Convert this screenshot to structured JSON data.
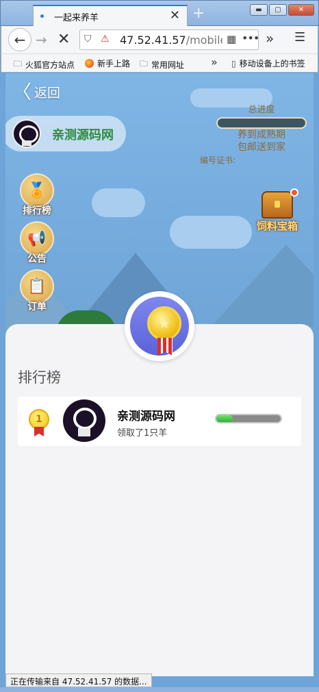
{
  "browser": {
    "tab_title": "一起来养羊",
    "url_host": "47.52.41.57",
    "url_path": "/mobile/she",
    "bookmarks": [
      "火狐官方站点",
      "新手上路",
      "常用网址",
      "移动设备上的书签"
    ],
    "status_text": "正在传输来自 47.52.41.57 的数据..."
  },
  "game": {
    "back_label": "返回",
    "username": "亲测源码网",
    "progress": {
      "title": "总进度",
      "line1": "养到成熟期",
      "line2": "包邮送到家",
      "cert_label": "编号证书:"
    },
    "side_menu": [
      {
        "label": "排行榜"
      },
      {
        "label": "公告"
      },
      {
        "label": "订单"
      }
    ],
    "chest_label": "饲料宝箱"
  },
  "ranking": {
    "title": "排行榜",
    "rows": [
      {
        "rank": "1",
        "name": "亲测源码网",
        "subtitle": "领取了1只羊",
        "progress": 0.25
      }
    ]
  },
  "colors": {
    "accent_green": "#2bb53a",
    "medal_purple": "#5a63d8",
    "sky": "#7fb6e6"
  }
}
